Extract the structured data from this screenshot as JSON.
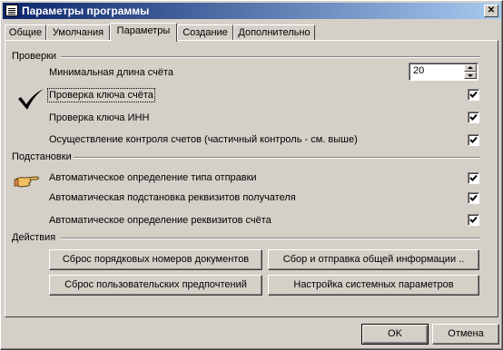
{
  "window": {
    "title": "Параметры программы"
  },
  "tabs": [
    {
      "label": "Общие"
    },
    {
      "label": "Умолчания"
    },
    {
      "label": "Параметры"
    },
    {
      "label": "Создание"
    },
    {
      "label": "Дополнительно"
    }
  ],
  "active_tab": "Параметры",
  "checks": {
    "section_title": "Проверки",
    "min_length_label": "Минимальная длина счёта",
    "min_length_value": "20",
    "items": [
      {
        "label": "Проверка ключа счёта",
        "checked": true
      },
      {
        "label": "Проверка ключа ИНН",
        "checked": true
      },
      {
        "label": "Осуществление контроля счетов (частичный контроль - см. выше)",
        "checked": true
      }
    ]
  },
  "substitutions": {
    "section_title": "Подстановки",
    "items": [
      {
        "label": "Автоматическое определение типа отправки",
        "checked": true
      },
      {
        "label": "Автоматическая подстановка реквизитов получателя",
        "checked": true
      },
      {
        "label": "Автоматическое определение реквизитов счёта",
        "checked": true
      }
    ]
  },
  "actions": {
    "section_title": "Действия",
    "reset_doc_numbers": "Сброс порядковых номеров документов",
    "collect_send_info": "Сбор и отправка общей информации ..",
    "reset_user_prefs": "Сброс пользовательских предпочтений",
    "system_settings": "Настройка системных параметров"
  },
  "footer": {
    "ok": "OK",
    "cancel": "Отмена"
  },
  "icons": {
    "checkmark": "checkmark-icon",
    "pointing_hand": "pointing-hand-icon",
    "close": "close-icon",
    "app": "app-icon"
  }
}
